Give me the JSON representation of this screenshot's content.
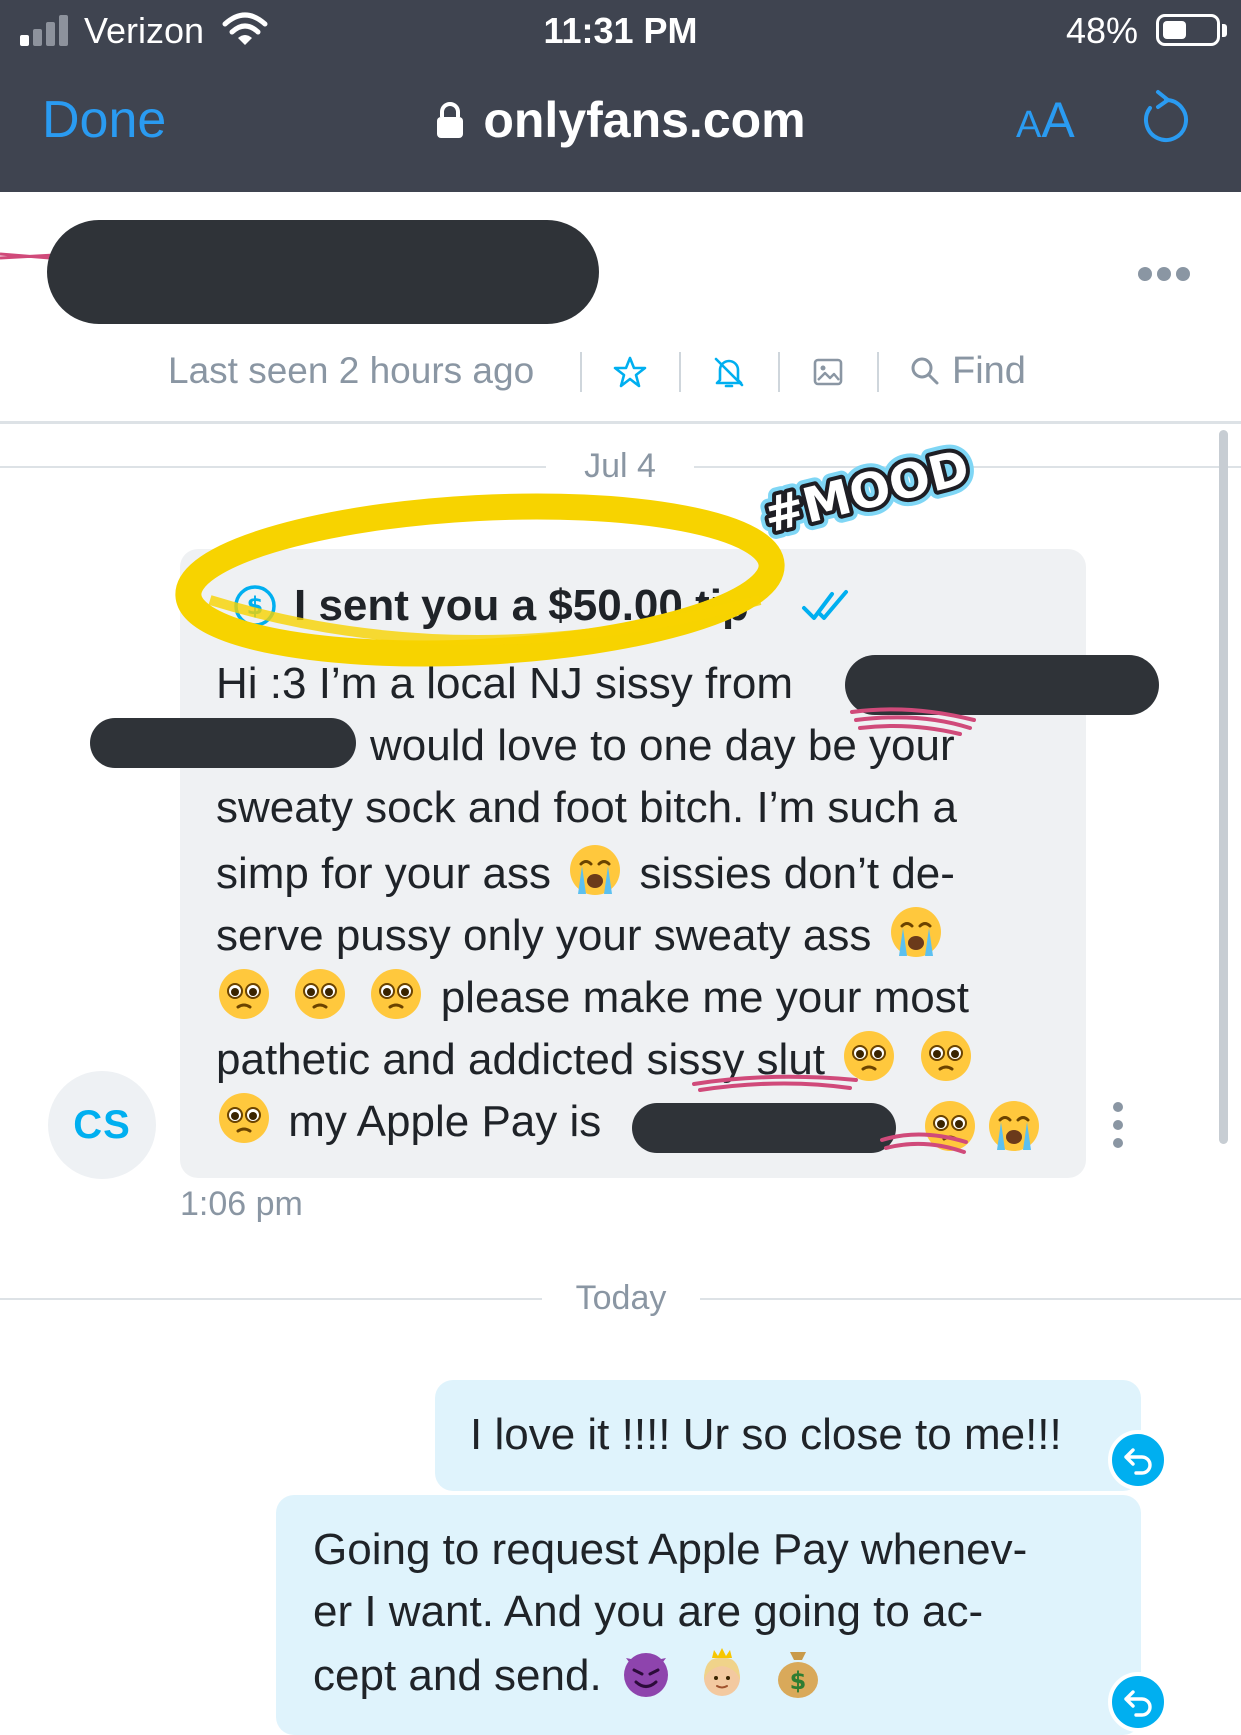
{
  "status_bar": {
    "carrier": "Verizon",
    "time": "11:31 PM",
    "battery_percent": "48%",
    "battery_level": 0.48,
    "signal_bars_filled": 1,
    "signal_bars_total": 4
  },
  "browser": {
    "done_label": "Done",
    "url": "onlyfans.com",
    "text_size_small": "A",
    "text_size_big": "A"
  },
  "chat_header": {
    "last_seen": "Last seen 2 hours ago",
    "find_label": "Find"
  },
  "dates": {
    "first": "Jul 4",
    "second": "Today"
  },
  "incoming_message": {
    "avatar_initials": "CS",
    "tip_text": "I sent you a $50.00 tip",
    "line1": "Hi :3 I’m a local NJ sissy from",
    "line2": "would love to one day be your",
    "line3": "sweaty sock and foot bitch. I’m such a",
    "line4a": "simp for your ass",
    "line4b": "sissies don’t de-",
    "line5": "serve pussy only your sweaty ass",
    "line6": "please make me your most",
    "line7": "pathetic and addicted sissy slut",
    "line8": "my Apple Pay is",
    "time": "1:06 pm"
  },
  "outgoing_messages": [
    {
      "lines": [
        "I love it !!!! Ur so close to me!!!"
      ]
    },
    {
      "lines": [
        "Going to request Apple Pay whenev-",
        "er I want. And you are going to ac-",
        "cept and send."
      ]
    }
  ],
  "annotation": {
    "sticker_text": "#MOOD"
  },
  "colors": {
    "accent": "#00aff0",
    "browser_bar": "#3f4450",
    "browser_link": "#2a9bf1",
    "incoming_bubble": "#eff1f3",
    "outgoing_bubble": "#dff3fc",
    "muted_text": "#8a96a3",
    "highlight": "#f7d300"
  },
  "icons": {
    "wifi": "wifi-icon",
    "lock": "lock-icon",
    "refresh": "refresh-icon",
    "star": "star-icon",
    "bell_off": "bell-off-icon",
    "gallery": "image-icon",
    "search": "search-icon",
    "tip": "dollar-icon",
    "read": "double-check-icon",
    "reply": "reply-icon",
    "more_horizontal": "more-horizontal-icon",
    "more_vertical": "more-vertical-icon"
  }
}
